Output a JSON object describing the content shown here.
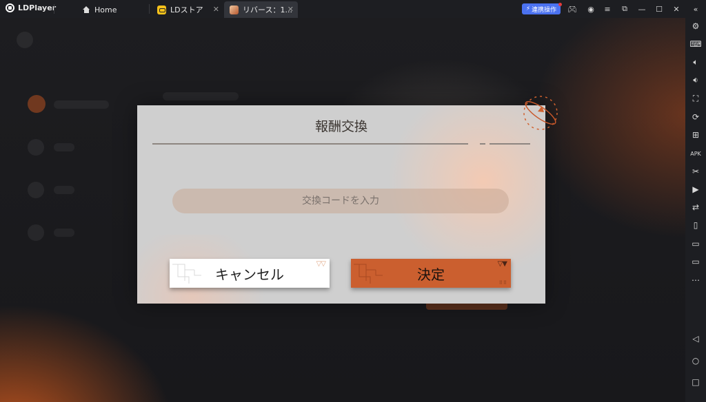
{
  "app": {
    "name": "LDPlayer"
  },
  "tabs": [
    {
      "label": "Home",
      "icon": "home-icon",
      "active": false
    },
    {
      "label": "LDストア",
      "icon": "store-icon",
      "active": false
    },
    {
      "label": "リバース：1...",
      "icon": "game-icon",
      "active": true
    }
  ],
  "titlebar": {
    "operation_button": "連携操作",
    "icons": [
      "gamepad-icon",
      "account-icon",
      "menu-icon",
      "popout-icon",
      "minimize-icon",
      "maximize-icon",
      "close-icon",
      "collapse-icon"
    ]
  },
  "sidebar": {
    "icons": [
      "settings-icon",
      "keyboard-icon",
      "volume-up-icon",
      "volume-down-icon",
      "screenshot-icon",
      "sync-icon",
      "add-app-icon",
      "apk-icon",
      "scissors-icon",
      "record-icon",
      "transfer-icon",
      "shake-icon",
      "folder-icon",
      "display-icon",
      "more-icon",
      "back-icon",
      "home-nav-icon",
      "recent-icon"
    ]
  },
  "dialog": {
    "title": "報酬交換",
    "input_placeholder": "交換コードを入力",
    "input_value": "",
    "cancel_label": "キャンセル",
    "confirm_label": "決定"
  },
  "colors": {
    "accent": "#cb5f2f",
    "operation_button": "#4b72f0",
    "dialog_bg": "#cfcfcf"
  }
}
